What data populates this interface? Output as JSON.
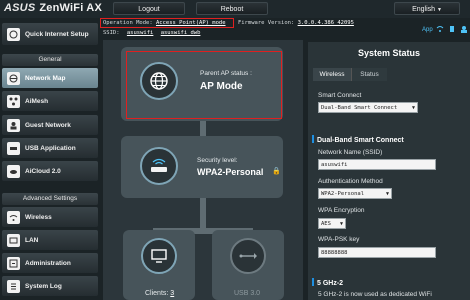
{
  "brand": {
    "name": "ZenWiFi AX",
    "logo": "ASUS"
  },
  "topbar": {
    "logout_label": "Logout",
    "reboot_label": "Reboot",
    "language_label": "English"
  },
  "info": {
    "opmode_label": "Operation Mode:",
    "opmode_value": "Access Point(AP) mode",
    "firmware_label": "Firmware Version:",
    "firmware_value": "3.0.0.4.386_42095",
    "ssid_label": "SSID:",
    "ssid_values": [
      "asuswifi",
      "asuswifi_dwb"
    ],
    "app_label": "App"
  },
  "sidebar": {
    "quick_setup": "Quick Internet Setup",
    "general_header": "General",
    "items": [
      {
        "label": "Network Map",
        "icon": "network-map-icon"
      },
      {
        "label": "AiMesh",
        "icon": "aimesh-icon"
      },
      {
        "label": "Guest Network",
        "icon": "guest-network-icon"
      },
      {
        "label": "USB Application",
        "icon": "usb-icon"
      },
      {
        "label": "AiCloud 2.0",
        "icon": "cloud-icon"
      }
    ],
    "advanced_header": "Advanced Settings",
    "advanced_items": [
      {
        "label": "Wireless",
        "icon": "wifi-icon"
      },
      {
        "label": "LAN",
        "icon": "lan-icon"
      },
      {
        "label": "Administration",
        "icon": "admin-icon"
      },
      {
        "label": "System Log",
        "icon": "log-icon"
      }
    ]
  },
  "map": {
    "parent_ap_label": "Parent AP status :",
    "parent_ap_value": "AP Mode",
    "security_label": "Security level:",
    "security_value": "WPA2-Personal",
    "clients_label": "Clients:",
    "clients_value": "3",
    "usb_label": "USB 3.0"
  },
  "status": {
    "title": "System Status",
    "tabs": [
      "Wireless",
      "Status"
    ],
    "smart_connect_label": "Smart Connect",
    "smart_connect_value": "Dual-Band Smart Connect",
    "dual_band_header": "Dual-Band Smart Connect",
    "network_name_label": "Network Name (SSID)",
    "network_name_value": "asuswifi",
    "auth_label": "Authentication Method",
    "auth_value": "WPA2-Personal",
    "encryption_label": "WPA Encryption",
    "encryption_value": "AES",
    "psk_label": "WPA-PSK key",
    "psk_value": "88888888",
    "band_header": "5 GHz-2",
    "band_note": "5 GHz-2 is now used as dedicated WiFi"
  },
  "colors": {
    "highlight": "#e02020",
    "accent": "#1f8fe0",
    "icon_ring": "#7fa5b6"
  }
}
